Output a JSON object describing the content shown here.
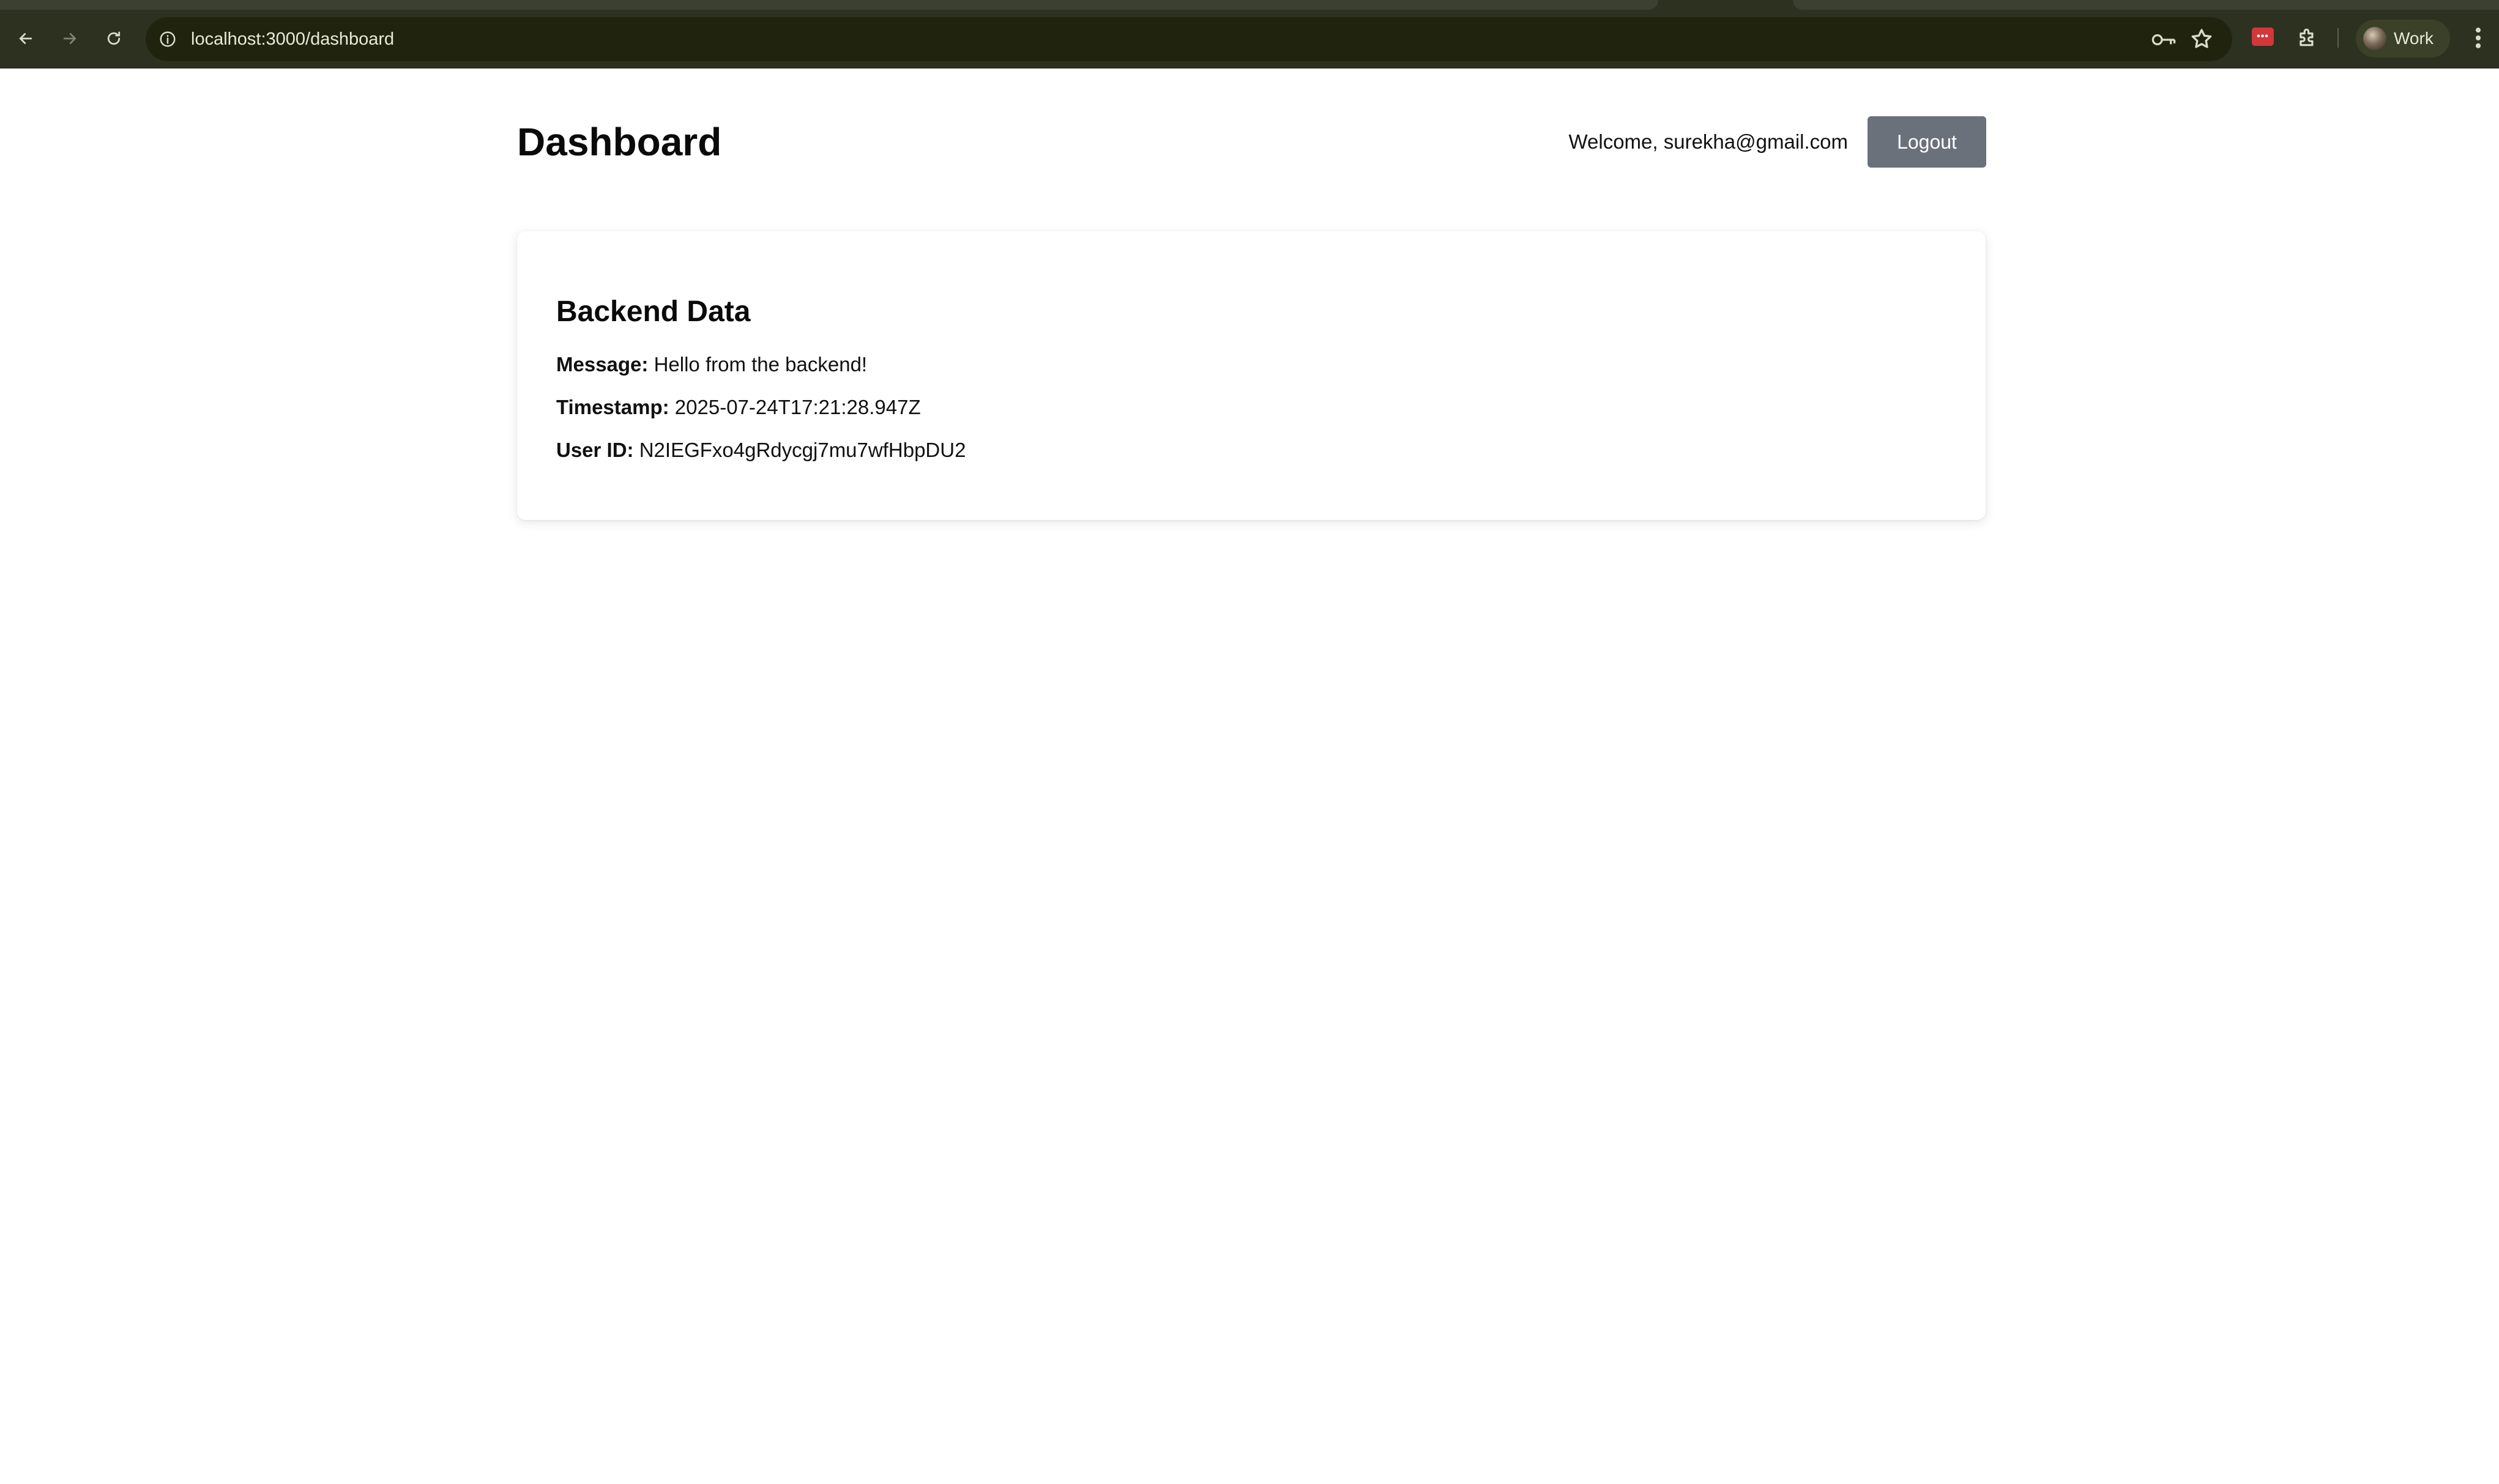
{
  "browser": {
    "url": "localhost:3000/dashboard",
    "profile_name": "Work",
    "icons": {
      "back": "arrow-left-icon",
      "forward": "arrow-right-icon",
      "reload": "reload-icon",
      "site_info": "info-icon",
      "password": "key-icon",
      "bookmark": "star-icon",
      "extension": "extension-red-icon",
      "extensions_menu": "puzzle-icon",
      "menu": "kebab-menu-icon"
    }
  },
  "header": {
    "title": "Dashboard",
    "welcome": "Welcome, surekha@gmail.com",
    "logout_label": "Logout"
  },
  "card": {
    "title": "Backend Data",
    "fields": [
      {
        "label": "Message:",
        "value": "Hello from the backend!"
      },
      {
        "label": "Timestamp:",
        "value": "2025-07-24T17:21:28.947Z"
      },
      {
        "label": "User ID:",
        "value": "N2IEGFxo4gRdycgj7mu7wfHbpDU2"
      }
    ]
  },
  "colors": {
    "chrome_bg": "#2c3120",
    "omnibox_bg": "#20240f",
    "logout_button": "#6b717b",
    "page_bg": "#ffffff"
  }
}
